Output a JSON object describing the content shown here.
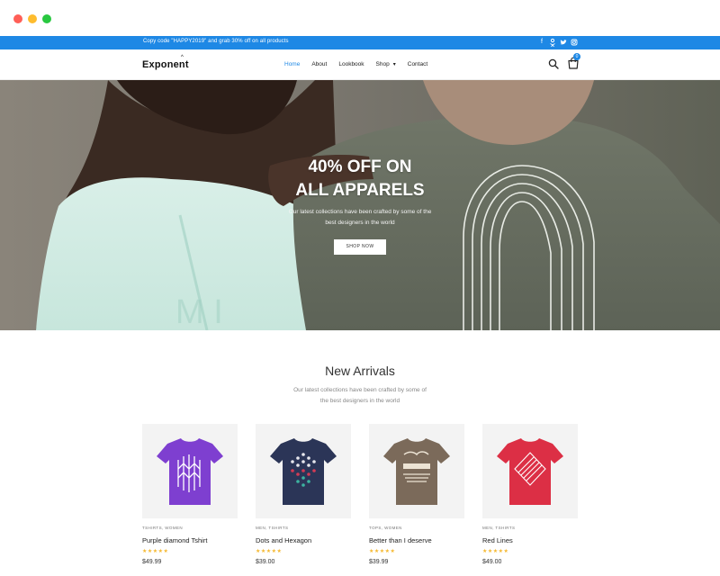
{
  "promo": {
    "text": "Copy code \"HAPPY2019\" and grab 30% off on all products",
    "social": [
      "facebook-icon",
      "vk-icon",
      "twitter-icon",
      "instagram-icon"
    ]
  },
  "header": {
    "logo": "Exponent",
    "menu": [
      {
        "label": "Home",
        "active": true
      },
      {
        "label": "About"
      },
      {
        "label": "Lookbook"
      },
      {
        "label": "Shop",
        "dropdown": true
      },
      {
        "label": "Contact"
      }
    ],
    "cart_count": "0",
    "icons": [
      "search-icon",
      "cart-icon"
    ]
  },
  "hero": {
    "title_line1": "40% OFF ON",
    "title_line2": "ALL APPARELS",
    "subtitle_line1": "Our latest collections have been crafted by some of the",
    "subtitle_line2": "best designers in the world",
    "button": "SHOP NOW"
  },
  "arrivals": {
    "title": "New Arrivals",
    "subtitle_line1": "Our latest collections have been crafted by some of",
    "subtitle_line2": "the best designers in the world",
    "products": [
      {
        "category": "TSHIRTS, WOMEN",
        "name": "Purple diamond Tshirt",
        "rating": "★★★★★",
        "price": "$49.99",
        "color": "#7e3fd0"
      },
      {
        "category": "MEN, TSHIRTS",
        "name": "Dots and Hexagon",
        "rating": "★★★★★",
        "price": "$39.00",
        "color": "#2b3557"
      },
      {
        "category": "TOPS, WOMEN",
        "name": "Better than I deserve",
        "rating": "★★★★★",
        "price": "$39.99",
        "color": "#7b6a5a"
      },
      {
        "category": "MEN, TSHIRTS",
        "name": "Red Lines",
        "rating": "★★★★★",
        "price": "$49.00",
        "color": "#dc2f45"
      }
    ]
  },
  "colors": {
    "accent": "#1e88e5",
    "star": "#f5b830"
  }
}
